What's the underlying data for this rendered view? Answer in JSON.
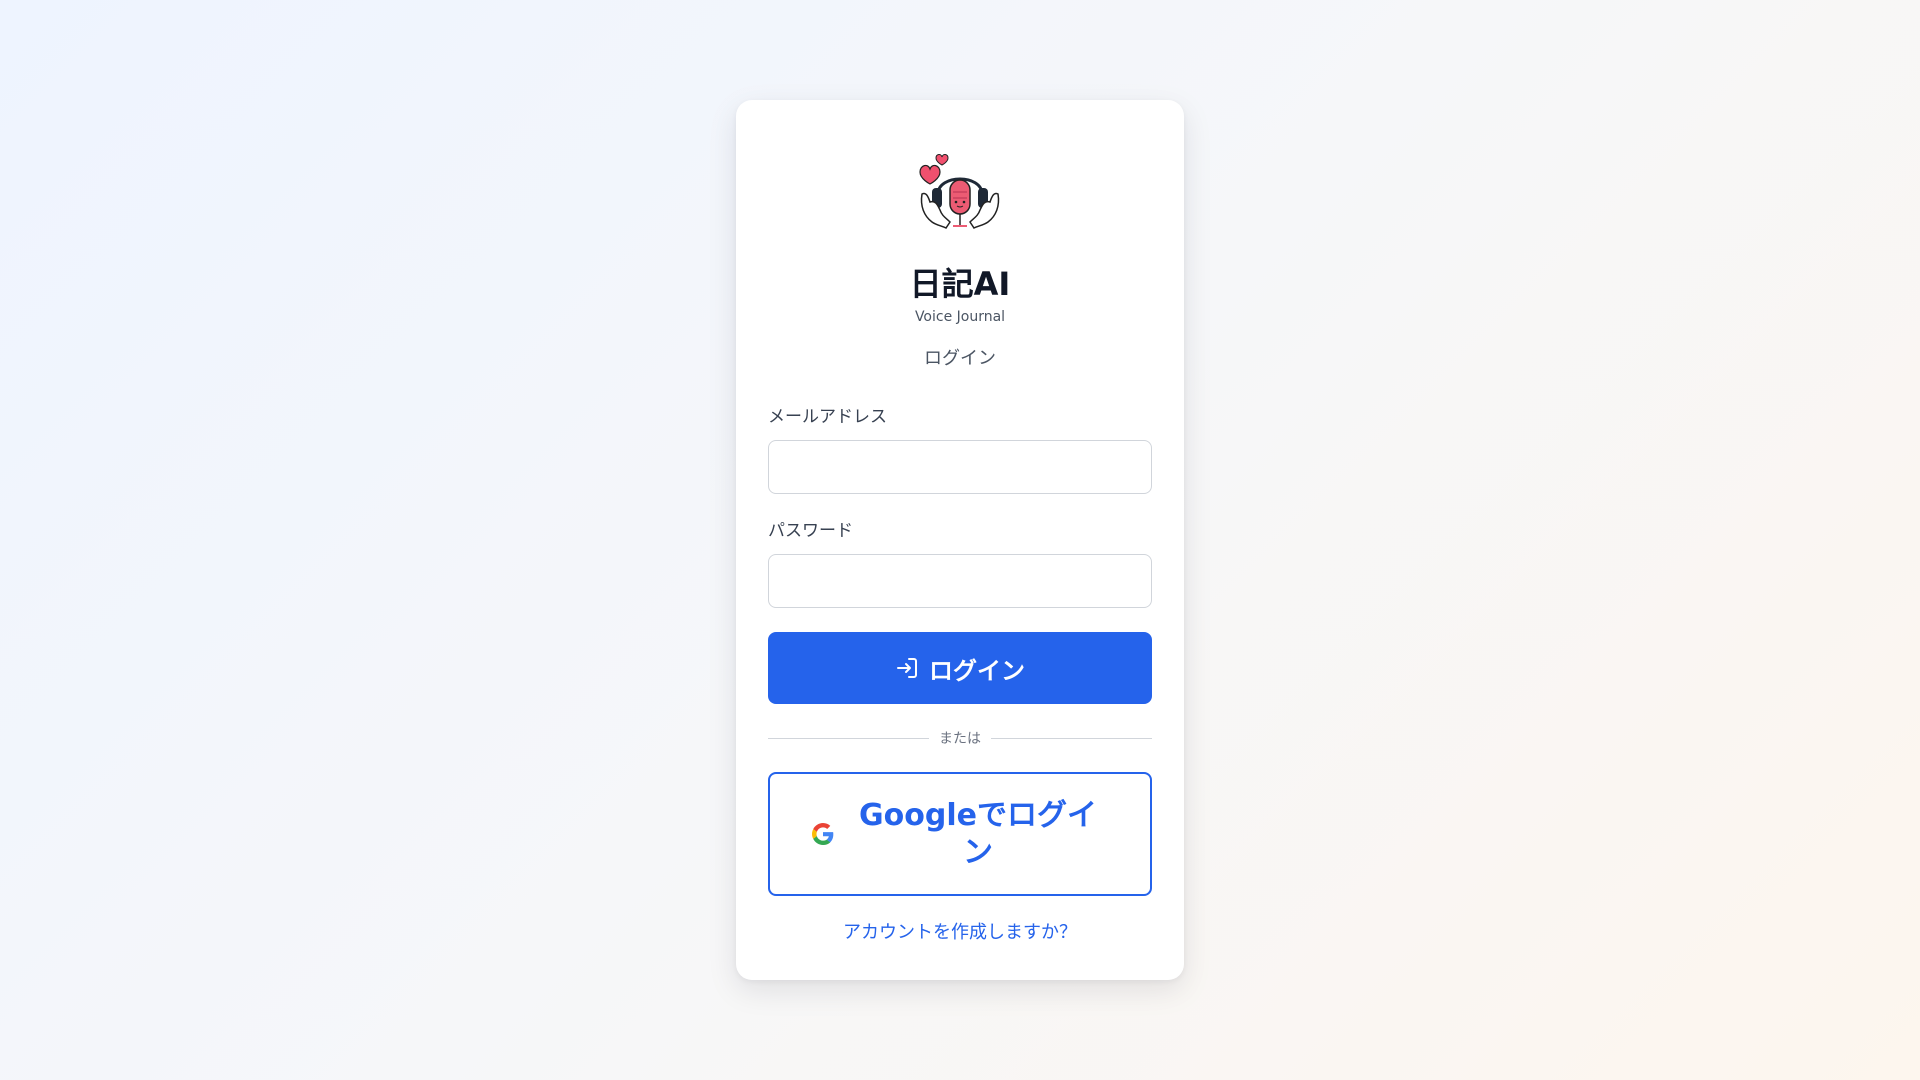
{
  "app": {
    "title": "日記AI",
    "subtitle": "Voice Journal",
    "logo_icon": "heart-headphones-microphone-hands-logo"
  },
  "form": {
    "heading": "ログイン",
    "email_label": "メールアドレス",
    "email_value": "",
    "password_label": "パスワード",
    "password_value": "",
    "login_button_label": "ログイン",
    "login_button_icon": "login-arrow-icon",
    "divider_text": "または",
    "google_button_label": "Googleでログイン",
    "google_button_icon": "google-g-icon",
    "signup_link": "アカウントを作成しますか？"
  },
  "colors": {
    "primary": "#2563eb",
    "text_dark": "#111827",
    "text_muted": "#4b5563",
    "heart": "#f0506e",
    "mic": "#ec5b73"
  }
}
